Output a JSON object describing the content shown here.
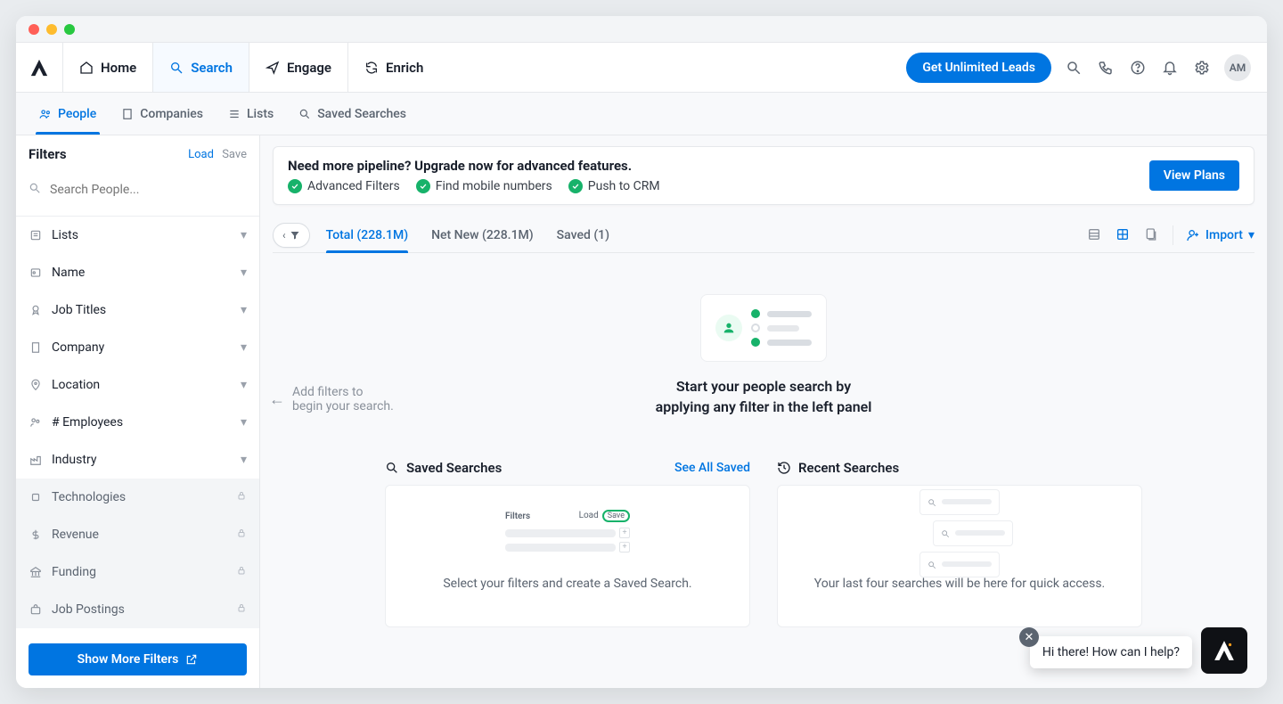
{
  "nav": {
    "home": "Home",
    "search": "Search",
    "engage": "Engage",
    "enrich": "Enrich",
    "cta": "Get Unlimited Leads",
    "avatar": "AM"
  },
  "subnav": {
    "people": "People",
    "companies": "Companies",
    "lists": "Lists",
    "saved": "Saved Searches"
  },
  "filters": {
    "title": "Filters",
    "load": "Load",
    "save": "Save",
    "search_placeholder": "Search People...",
    "items": [
      {
        "label": "Lists"
      },
      {
        "label": "Name"
      },
      {
        "label": "Job Titles"
      },
      {
        "label": "Company"
      },
      {
        "label": "Location"
      },
      {
        "label": "# Employees"
      },
      {
        "label": "Industry"
      }
    ],
    "locked": [
      {
        "label": "Technologies"
      },
      {
        "label": "Revenue"
      },
      {
        "label": "Funding"
      },
      {
        "label": "Job Postings"
      }
    ],
    "more": "Show More Filters"
  },
  "banner": {
    "headline": "Need more pipeline? Upgrade now for advanced features.",
    "feats": [
      "Advanced Filters",
      "Find mobile numbers",
      "Push to CRM"
    ],
    "cta": "View Plans"
  },
  "tabs": {
    "total": "Total (228.1M)",
    "netnew": "Net New (228.1M)",
    "saved": "Saved (1)",
    "import": "Import"
  },
  "hint": {
    "l1": "Add filters to",
    "l2": "begin your search."
  },
  "empty": {
    "l1": "Start your people search by",
    "l2": "applying any filter in the left panel"
  },
  "cards": {
    "saved_title": "Saved Searches",
    "see_all": "See All Saved",
    "saved_desc": "Select your filters and create a Saved Search.",
    "mini_filters": "Filters",
    "mini_load": "Load",
    "mini_save": "Save",
    "recent_title": "Recent Searches",
    "recent_desc": "Your last four searches will be here for quick access."
  },
  "chat": {
    "msg": "Hi there! How can I help?"
  }
}
